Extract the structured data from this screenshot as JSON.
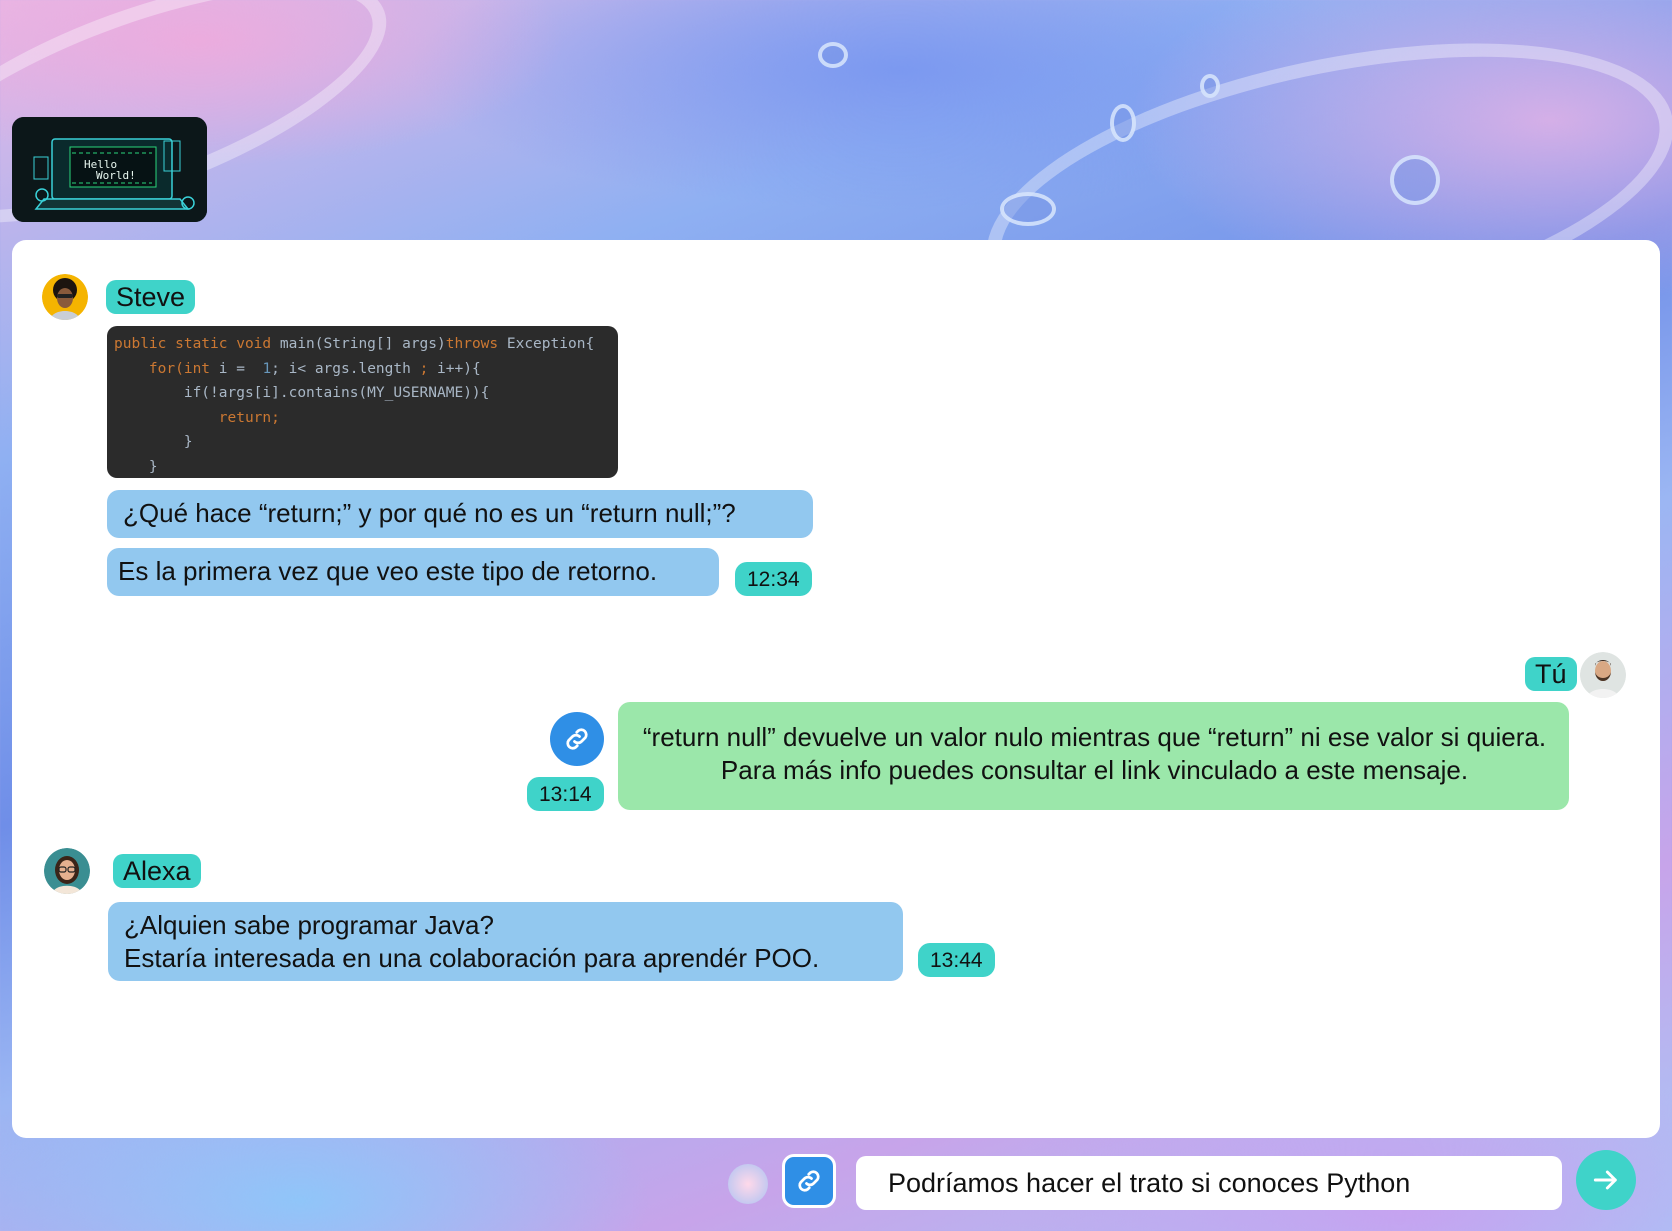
{
  "thumbnail": {
    "line1": "Hello",
    "line2": "World!"
  },
  "messages": {
    "steve": {
      "name": "Steve",
      "code_lines": [
        [
          "public static void",
          " main(String[] args)",
          "throws",
          " Exception{"
        ],
        [
          "    for(",
          "int",
          " i =  ",
          "1",
          "; i< args.length ",
          ";",
          " i++){"
        ],
        [
          "        if(!args[i].contains(MY_USERNAME)){"
        ],
        [
          "            ",
          "return;"
        ],
        [
          "        }"
        ],
        [
          "    }"
        ]
      ],
      "text1": "¿Qué hace “return;” y por qué no es un “return null;”?",
      "text2": "Es la primera vez que veo este tipo de retorno.",
      "time": "12:34"
    },
    "you": {
      "name": "Tú",
      "text": "“return null” devuelve un valor nulo mientras que “return” ni ese valor si quiera. Para más info puedes consultar el link vinculado a este mensaje.",
      "time": "13:14"
    },
    "alexa": {
      "name": "Alexa",
      "line1": "¿Alquien sabe programar Java?",
      "line2": "Estaría interesada en una colaboración para aprendér POO.",
      "time": "13:44"
    }
  },
  "composer": {
    "input_value": "Podríamos hacer el trato si conoces Python"
  },
  "colors": {
    "accent_teal": "#3fd3c9",
    "bubble_blue": "#92c8ef",
    "bubble_green": "#9be7aa",
    "link_blue": "#2f8fe6"
  }
}
